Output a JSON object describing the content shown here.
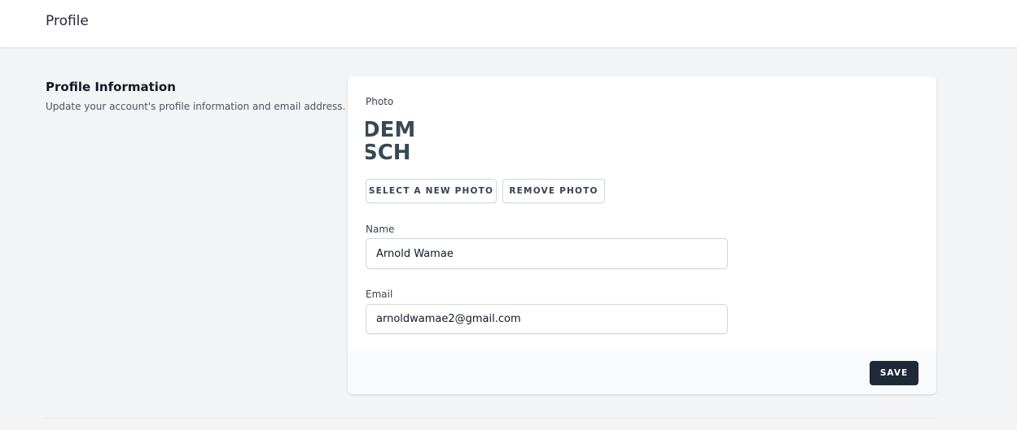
{
  "header": {
    "title": "Profile"
  },
  "section": {
    "title": "Profile Information",
    "description": "Update your account's profile information and email address."
  },
  "form": {
    "photo_label": "Photo",
    "photo_text_line1": "DEM",
    "photo_text_line2": "SCH",
    "select_photo_label": "Select A New Photo",
    "remove_photo_label": "Remove Photo",
    "name_label": "Name",
    "name_value": "Arnold Wamae",
    "email_label": "Email",
    "email_value": "arnoldwamae2@gmail.com",
    "save_label": "Save"
  },
  "colors": {
    "page_bg": "#f3f4f6",
    "card_bg": "#ffffff",
    "save_button_bg": "#1f2937",
    "photo_text": "#374955"
  }
}
